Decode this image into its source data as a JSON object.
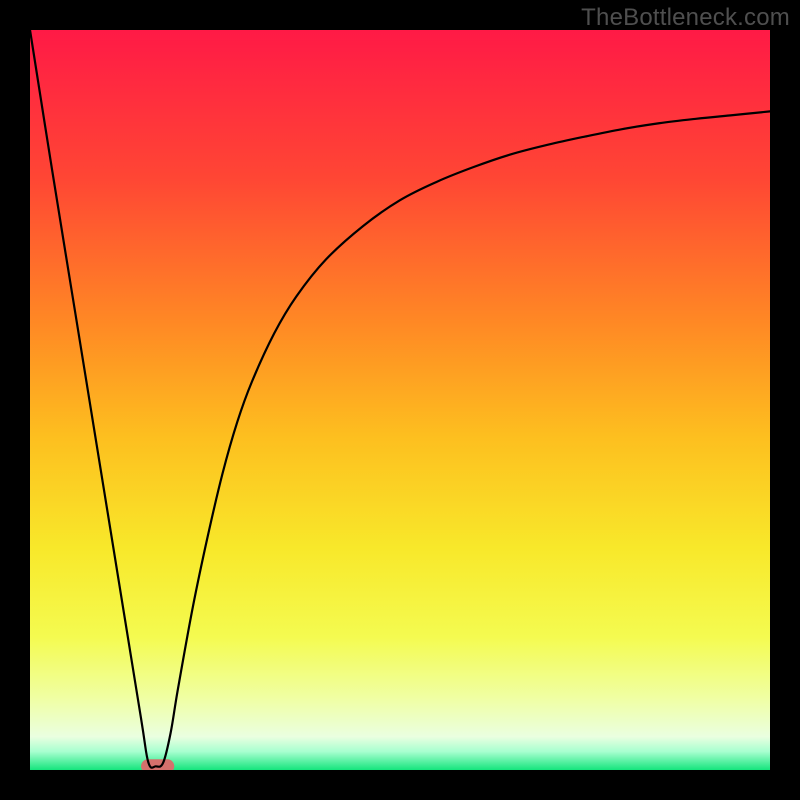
{
  "watermark": "TheBottleneck.com",
  "chart_data": {
    "type": "line",
    "title": "",
    "xlabel": "",
    "ylabel": "",
    "xlim": [
      0,
      100
    ],
    "ylim": [
      0,
      100
    ],
    "grid": false,
    "legend": false,
    "background": {
      "type": "vertical-gradient",
      "stops": [
        {
          "pos": 0.0,
          "color": "#ff1a46"
        },
        {
          "pos": 0.2,
          "color": "#ff4634"
        },
        {
          "pos": 0.4,
          "color": "#ff8a24"
        },
        {
          "pos": 0.55,
          "color": "#fdbf1f"
        },
        {
          "pos": 0.7,
          "color": "#f8e82a"
        },
        {
          "pos": 0.82,
          "color": "#f4fb50"
        },
        {
          "pos": 0.9,
          "color": "#f0ffa0"
        },
        {
          "pos": 0.955,
          "color": "#eaffe0"
        },
        {
          "pos": 0.975,
          "color": "#a8ffd0"
        },
        {
          "pos": 1.0,
          "color": "#15e57d"
        }
      ]
    },
    "optimal_marker": {
      "x_start": 15.0,
      "x_end": 19.5,
      "y": 0.5,
      "color": "#d4706c"
    },
    "series": [
      {
        "name": "bottleneck-curve",
        "color": "#000000",
        "x": [
          0.0,
          3.0,
          6.0,
          9.0,
          12.0,
          15.0,
          16.0,
          17.0,
          18.0,
          19.0,
          20.0,
          22.0,
          24.0,
          26.0,
          28.0,
          30.0,
          33.0,
          36.0,
          40.0,
          45.0,
          50.0,
          55.0,
          60.0,
          65.0,
          70.0,
          75.0,
          80.0,
          85.0,
          90.0,
          95.0,
          100.0
        ],
        "y": [
          100.0,
          81.0,
          62.5,
          44.0,
          25.5,
          7.0,
          1.0,
          0.5,
          1.0,
          5.0,
          11.0,
          22.0,
          31.5,
          40.0,
          47.0,
          52.5,
          59.0,
          64.0,
          69.0,
          73.5,
          77.0,
          79.5,
          81.5,
          83.2,
          84.5,
          85.6,
          86.6,
          87.4,
          88.0,
          88.5,
          89.0
        ]
      }
    ]
  }
}
